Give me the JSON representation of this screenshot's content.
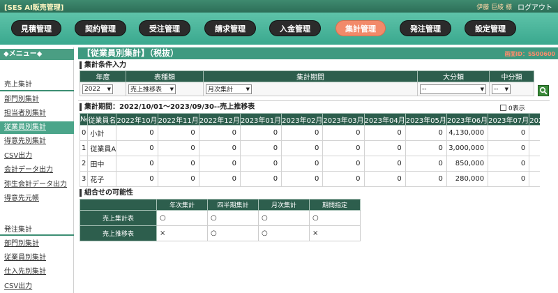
{
  "header": {
    "app_title": "[SES AI販売管理]",
    "user_name": "伊藤 巨綾 様",
    "logout": "ログアウト"
  },
  "nav": {
    "items": [
      {
        "label": "見積管理"
      },
      {
        "label": "契約管理"
      },
      {
        "label": "受注管理"
      },
      {
        "label": "請求管理"
      },
      {
        "label": "入金管理"
      },
      {
        "label": "集計管理",
        "active": true
      },
      {
        "label": "発注管理"
      },
      {
        "label": "設定管理"
      }
    ]
  },
  "sidebar": {
    "menu_title": "◆メニュー◆",
    "sales_section": "売上集計",
    "sales_items": [
      {
        "label": "部門別集計"
      },
      {
        "label": "担当者別集計"
      },
      {
        "label": "従業員別集計",
        "active": true
      },
      {
        "label": "得意先別集計"
      },
      {
        "label": "CSV出力"
      },
      {
        "label": "会計データ出力"
      },
      {
        "label": "弥生会計データ出力"
      },
      {
        "label": "得意先元帳"
      }
    ],
    "order_section": "発注集計",
    "order_items": [
      {
        "label": "部門別集計"
      },
      {
        "label": "従業員別集計"
      },
      {
        "label": "仕入先別集計"
      },
      {
        "label": "CSV出力"
      }
    ]
  },
  "page": {
    "title": "【従業員別集計】（税抜）",
    "screen_id": "画面ID：SS00600"
  },
  "conditions": {
    "label": "集計条件入力",
    "headers": {
      "year": "年度",
      "table_type": "表種類",
      "period": "集計期間",
      "major": "大分類",
      "minor": "中分類"
    },
    "year_value": "2022",
    "table_type_value": "売上推移表",
    "period_value": "月次集計",
    "major_value": "--",
    "minor_value": "--"
  },
  "results": {
    "period_label": "集計期間：2022/10/01～2023/09/30--売上推移表",
    "zero_display": "0表示",
    "columns": [
      "№",
      "従業員名",
      "2022年10月",
      "2022年11月",
      "2022年12月",
      "2023年01月",
      "2023年02月",
      "2023年03月",
      "2023年04月",
      "2023年05月",
      "2023年06月",
      "2023年07月",
      "2023年0"
    ],
    "rows": [
      [
        "0",
        "小計",
        "0",
        "0",
        "0",
        "0",
        "0",
        "0",
        "0",
        "0",
        "4,130,000",
        "0",
        ""
      ],
      [
        "1",
        "従業員A",
        "0",
        "0",
        "0",
        "0",
        "0",
        "0",
        "0",
        "0",
        "3,000,000",
        "0",
        ""
      ],
      [
        "2",
        "田中",
        "0",
        "0",
        "0",
        "0",
        "0",
        "0",
        "0",
        "0",
        "850,000",
        "0",
        ""
      ],
      [
        "3",
        "花子",
        "0",
        "0",
        "0",
        "0",
        "0",
        "0",
        "0",
        "0",
        "280,000",
        "0",
        ""
      ]
    ]
  },
  "combinations": {
    "label": "組合せの可能性",
    "columns": [
      "",
      "年次集計",
      "四半期集計",
      "月次集計",
      "期間指定"
    ],
    "rows": [
      [
        "売上集計表",
        "○",
        "○",
        "○",
        "○"
      ],
      [
        "売上推移表",
        "×",
        "○",
        "○",
        "×"
      ]
    ]
  },
  "icons": {
    "search": "search-icon",
    "caret": "chevron-down-icon"
  },
  "colors": {
    "header_green": "#2d5e4d",
    "nav_band": "#3aa88e",
    "nav_active": "#f28a6a",
    "sidebar_active": "#4ba58a"
  }
}
